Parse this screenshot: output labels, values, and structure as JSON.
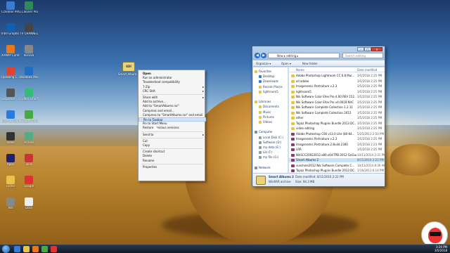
{
  "colors": {
    "selection": "#cce4fb",
    "menu_highlight": "#d3e5fa",
    "folder": "#e8c34a",
    "accent": "#2f6fc7"
  },
  "desktop_icons": [
    {
      "label": "Ccleaner PRO Con",
      "icon": "ccleaner-icon",
      "color": "#3a7bd5"
    },
    {
      "label": "CCleaner Pro",
      "icon": "ccleaner-icon",
      "color": "#2e8b57"
    },
    {
      "label": "Intel Graphics",
      "icon": "intel-icon",
      "color": "#1060b0"
    },
    {
      "label": "TV CHANNEL",
      "icon": "tv-icon",
      "color": "#444"
    },
    {
      "label": "XAMPP Control",
      "icon": "xampp-icon",
      "color": "#e8781e"
    },
    {
      "label": "Recuva",
      "icon": "recuva-icon",
      "color": "#888"
    },
    {
      "label": "Updating 1...",
      "icon": "update-icon",
      "color": "#d43"
    },
    {
      "label": "Windows Media",
      "icon": "media-icon",
      "color": "#1e6fc4"
    },
    {
      "label": "Sequence ... 1",
      "icon": "video-icon",
      "color": "#555"
    },
    {
      "label": "FixWin SmartWin...",
      "icon": "tool-icon",
      "color": "#3b7"
    },
    {
      "label": "Internet Explorer",
      "icon": "ie-icon",
      "color": "#2a7be0"
    },
    {
      "label": "Google Chrome",
      "icon": "chrome-icon",
      "color": "#4a4"
    },
    {
      "label": "Video",
      "icon": "video-icon",
      "color": "#333"
    },
    {
      "label": "Picture",
      "icon": "picture-icon",
      "color": "#5a8"
    },
    {
      "label": "Apps",
      "icon": "apps-icon",
      "color": "#226"
    },
    {
      "label": "Tools",
      "icon": "tool-icon",
      "color": "#c33"
    },
    {
      "label": "Folder",
      "icon": "folder-icon",
      "color": "#e8c34a"
    },
    {
      "label": "Google",
      "icon": "google-icon",
      "color": "#d33"
    },
    {
      "label": "Ads",
      "icon": "ads-icon",
      "color": "#888"
    },
    {
      "label": "Docs",
      "icon": "doc-icon",
      "color": "#eee"
    }
  ],
  "zip_icon": {
    "glyph": "SDI",
    "label": "Smart Album..."
  },
  "context_menu": [
    {
      "label": "Open",
      "bold": true
    },
    {
      "label": "Run as administrator"
    },
    {
      "label": "Troubleshoot compatibility"
    },
    {
      "label": "7-Zip",
      "sub": true
    },
    {
      "label": "CRC SHA",
      "sub": true
    },
    {
      "sep": true
    },
    {
      "label": "Share with",
      "sub": true
    },
    {
      "label": "Add to archive..."
    },
    {
      "label": "Add to \"SmartAlbums.rar\""
    },
    {
      "label": "Compress and email..."
    },
    {
      "label": "Compress to \"SmartAlbums.rar\" and email"
    },
    {
      "label": "Pin to Taskbar",
      "highlight": true
    },
    {
      "label": "Pin to Start Menu"
    },
    {
      "label": "Restore previous versions"
    },
    {
      "sep": true
    },
    {
      "label": "Send to",
      "sub": true
    },
    {
      "sep": true
    },
    {
      "label": "Cut"
    },
    {
      "label": "Copy"
    },
    {
      "sep": true
    },
    {
      "label": "Create shortcut"
    },
    {
      "label": "Delete"
    },
    {
      "label": "Rename"
    },
    {
      "sep": true
    },
    {
      "label": "Properties"
    }
  ],
  "explorer": {
    "address": "New ▸ editing ▸",
    "search_placeholder": "Search editing",
    "toolbar": {
      "organize": "Organize ▾",
      "open": "Open ▾",
      "new_folder": "New folder"
    },
    "columns": {
      "name": "Name",
      "date": "Date modified"
    },
    "nav": [
      {
        "label": "Favorites",
        "color": "#e8c34a",
        "indent": 0
      },
      {
        "label": "Desktop",
        "color": "#3a7bd5",
        "indent": 1
      },
      {
        "label": "Downloads",
        "color": "#3a7bd5",
        "indent": 1
      },
      {
        "label": "Recent Places",
        "color": "#e8c34a",
        "indent": 1
      },
      {
        "label": "lightroom5",
        "color": "#e8c34a",
        "indent": 1
      },
      {
        "label": "",
        "color": "",
        "indent": 0
      },
      {
        "label": "Libraries",
        "color": "#e8c34a",
        "indent": 0
      },
      {
        "label": "Documents",
        "color": "#e8c34a",
        "indent": 1
      },
      {
        "label": "Music",
        "color": "#e8c34a",
        "indent": 1
      },
      {
        "label": "Pictures",
        "color": "#e8c34a",
        "indent": 1
      },
      {
        "label": "Videos",
        "color": "#e8c34a",
        "indent": 1
      },
      {
        "label": "",
        "color": "",
        "indent": 0
      },
      {
        "label": "Computer",
        "color": "#6a8fb5",
        "indent": 0
      },
      {
        "label": "Local Disk (C:)",
        "color": "#999",
        "indent": 1
      },
      {
        "label": "Software (D:)",
        "color": "#999",
        "indent": 1
      },
      {
        "label": "my data (E:)",
        "color": "#999",
        "indent": 1
      },
      {
        "label": "Lib (F:)",
        "color": "#999",
        "indent": 1
      },
      {
        "label": "my file (G:)",
        "color": "#999",
        "indent": 1
      },
      {
        "label": "",
        "color": "",
        "indent": 0
      },
      {
        "label": "Network",
        "color": "#6a8fb5",
        "indent": 0
      }
    ],
    "files": [
      {
        "name": "Adobe Photoshop Lightroom CC 6.8 Mul...",
        "date": "3/5/2018 2:25 PM",
        "type": "folder"
      },
      {
        "name": "all adobe",
        "date": "3/5/2018 2:25 PM",
        "type": "folder"
      },
      {
        "name": "Imagenomic Portraiture v.2.3",
        "date": "3/5/2018 2:25 PM",
        "type": "folder"
      },
      {
        "name": "lightroom5",
        "date": "3/5/2018 2:25 PM",
        "type": "folder"
      },
      {
        "name": "Nik Software Color Efex Pro 4.00 REV 152...",
        "date": "3/5/2018 2:25 PM",
        "type": "folder"
      },
      {
        "name": "Nik Software Color Efex Pro v4.0018 NVC",
        "date": "3/5/2018 2:25 PM",
        "type": "folder"
      },
      {
        "name": "Nik Software Complete Collection 1.2.11",
        "date": "3/5/2018 2:25 PM",
        "type": "folder"
      },
      {
        "name": "Nik Software Complete Collection 2012",
        "date": "3/5/2018 2:25 PM",
        "type": "folder"
      },
      {
        "name": "other",
        "date": "3/5/2018 2:25 PM",
        "type": "folder"
      },
      {
        "name": "Topaz Photoshop Plugins Bundle 2013 DC...",
        "date": "3/5/2018 2:25 PM",
        "type": "folder"
      },
      {
        "name": "video editing",
        "date": "3/5/2018 2:25 PM",
        "type": "folder"
      },
      {
        "name": "Adobe Photoshop CS6 v13.0 Lite (80-64...",
        "date": "5/25/2013 2:50 PM",
        "type": "archive"
      },
      {
        "name": "Imagenomic Portraiture v.2.3",
        "date": "3/5/2018 2:25 PM",
        "type": "archive"
      },
      {
        "name": "Imagenomic.Portraiture.2.Build.2300",
        "date": "3/5/2018 2:23 PM",
        "type": "archive"
      },
      {
        "name": "LRR",
        "date": "3/5/2018 2:25 PM",
        "type": "archive"
      },
      {
        "name": "NikSCC20022012.x86.x64-TPB-2012 GoGun...",
        "date": "10/11/2014 2:31 PM",
        "type": "archive"
      },
      {
        "name": "Smart Albums 2",
        "date": "8/11/2016 2:22 PM",
        "type": "archive",
        "selected": true
      },
      {
        "name": "sunshine2012.Nik Software Complete C...",
        "date": "10/13/2014 8:30 AM",
        "type": "archive"
      },
      {
        "name": "Topaz Photoshop Plugins Bundle 2013 DC...",
        "date": "1/16/2013 6:14 PM",
        "type": "archive"
      }
    ],
    "details": {
      "name": "Smart Albums 2",
      "modified": "Date modified: 8/11/2016 2:22 PM",
      "type": "WinRAR archive",
      "size": "Size: 94.3 MB"
    }
  },
  "taskbar": {
    "time": "3:26 PM",
    "date": "3/5/2018"
  }
}
